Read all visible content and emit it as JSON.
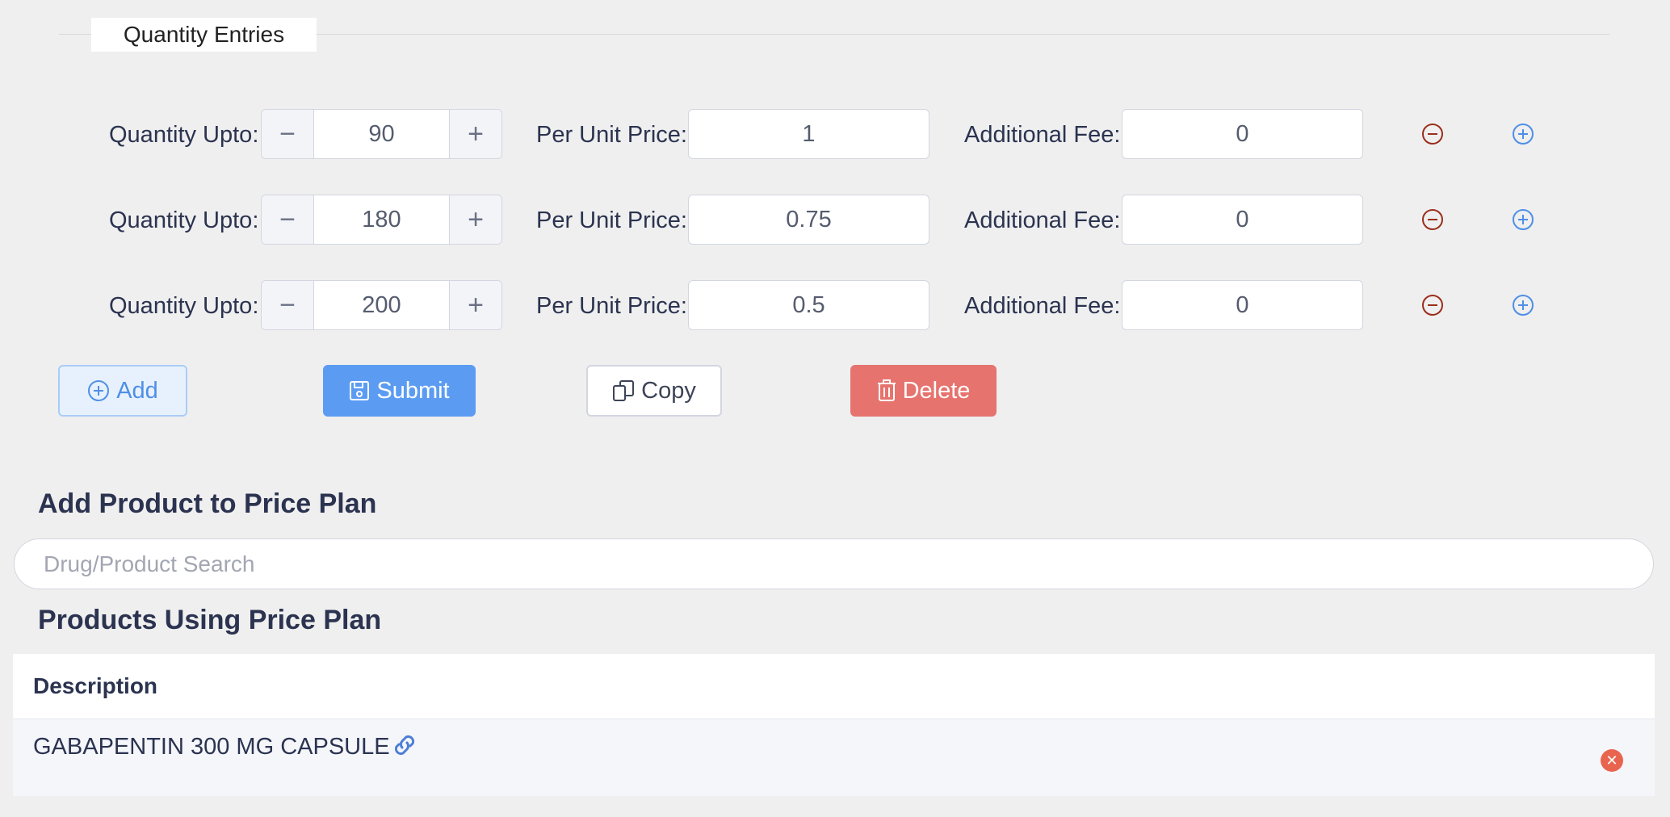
{
  "quantity_entries": {
    "legend": "Quantity Entries",
    "rows": [
      {
        "qty_label": "Quantity Upto:",
        "qty": "90",
        "ppu_label": "Per Unit Price:",
        "ppu": "1",
        "fee_label": "Additional Fee:",
        "fee": "0"
      },
      {
        "qty_label": "Quantity Upto:",
        "qty": "180",
        "ppu_label": "Per Unit Price:",
        "ppu": "0.75",
        "fee_label": "Additional Fee:",
        "fee": "0"
      },
      {
        "qty_label": "Quantity Upto:",
        "qty": "200",
        "ppu_label": "Per Unit Price:",
        "ppu": "0.5",
        "fee_label": "Additional Fee:",
        "fee": "0"
      }
    ]
  },
  "actions": {
    "add": "Add",
    "submit": "Submit",
    "copy": "Copy",
    "delete": "Delete"
  },
  "add_product": {
    "title": "Add Product to Price Plan",
    "search_placeholder": "Drug/Product Search"
  },
  "products": {
    "title": "Products Using Price Plan",
    "columns": [
      "Description"
    ],
    "rows": [
      {
        "description": "GABAPENTIN 300 MG CAPSULE"
      }
    ]
  },
  "colors": {
    "background": "#efefef",
    "primary": "#5b9cf2",
    "danger": "#e6736e",
    "remove_icon": "#9b2e1c",
    "add_icon": "#4f8fe6"
  }
}
